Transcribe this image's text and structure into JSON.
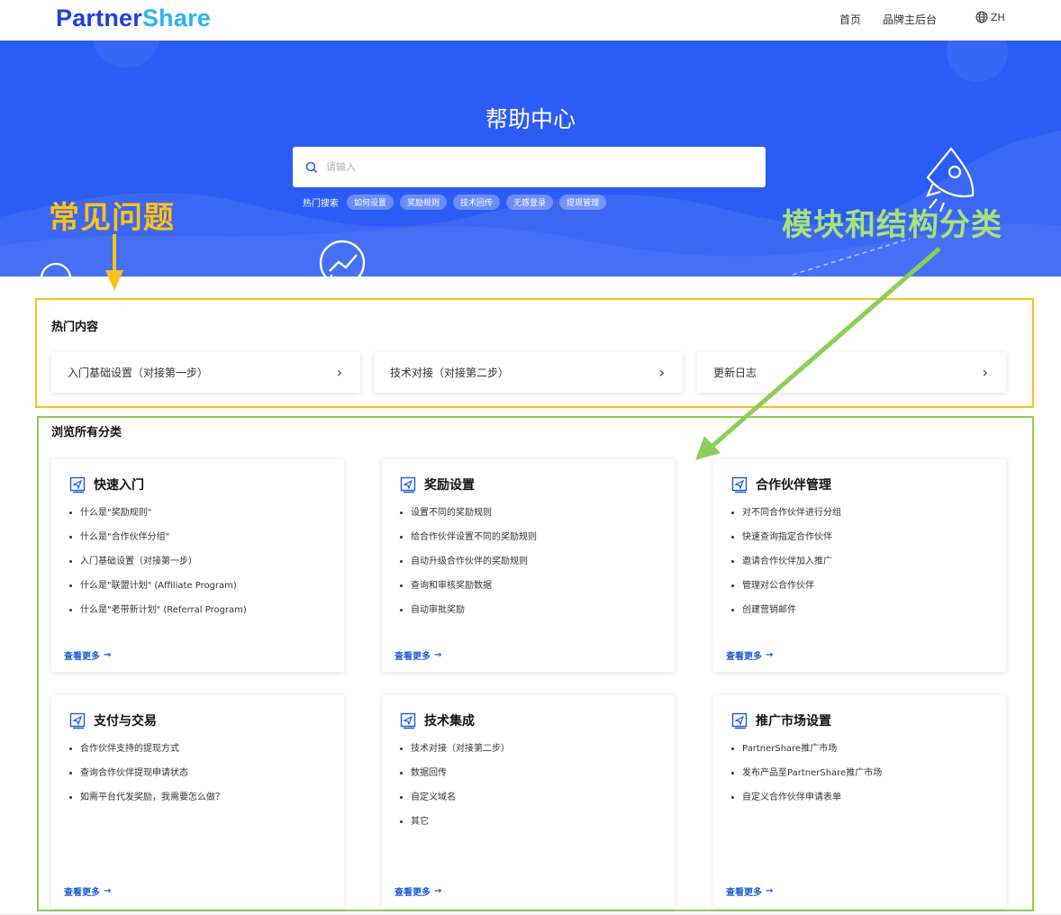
{
  "header": {
    "logo_part1": "Partner",
    "logo_part2": "Share",
    "nav": [
      "首页",
      "品牌主后台"
    ],
    "lang": "ZH"
  },
  "hero": {
    "title": "帮助中心",
    "search_placeholder": "请输入",
    "hot_search_label": "热门搜索",
    "hot_tags": [
      "如何设置",
      "奖励规则",
      "技术回传",
      "无感登录",
      "提现管理"
    ]
  },
  "annotations": {
    "faq": "常见问题",
    "module": "模块和结构分类"
  },
  "hot": {
    "title": "热门内容",
    "items": [
      "入门基础设置（对接第一步）",
      "技术对接（对接第二步）",
      "更新日志"
    ]
  },
  "categories": {
    "title": "浏览所有分类",
    "more_label": "查看更多",
    "items": [
      {
        "title": "快速入门",
        "links": [
          "什么是\"奖励规则\"",
          "什么是\"合作伙伴分组\"",
          "入门基础设置（对接第一步）",
          "什么是\"联盟计划\" (Affiliate Program)",
          "什么是\"老带新计划\" (Referral Program)"
        ]
      },
      {
        "title": "奖励设置",
        "links": [
          "设置不同的奖励规则",
          "给合作伙伴设置不同的奖励规则",
          "自动升级合作伙伴的奖励规则",
          "查询和审核奖励数据",
          "自动审批奖励"
        ]
      },
      {
        "title": "合作伙伴管理",
        "links": [
          "对不同合作伙伴进行分组",
          "快速查询指定合作伙伴",
          "邀请合作伙伴加入推广",
          "管理对公合作伙伴",
          "创建营销邮件"
        ]
      },
      {
        "title": "支付与交易",
        "links": [
          "合作伙伴支持的提现方式",
          "查询合作伙伴提现申请状态",
          "如需平台代发奖励，我需要怎么做？"
        ]
      },
      {
        "title": "技术集成",
        "links": [
          "技术对接（对接第二步）",
          "数据回传",
          "自定义域名",
          "其它"
        ]
      },
      {
        "title": "推广市场设置",
        "links": [
          "PartnerShare推广市场",
          "发布产品至PartnerShare推广市场",
          "自定义合作伙伴申请表单"
        ]
      }
    ]
  },
  "colors": {
    "hero_bg": "#2b5cf5",
    "link": "#1a5bd6",
    "faq_annotation": "#ffc21a",
    "module_annotation": "#a8e27a"
  }
}
